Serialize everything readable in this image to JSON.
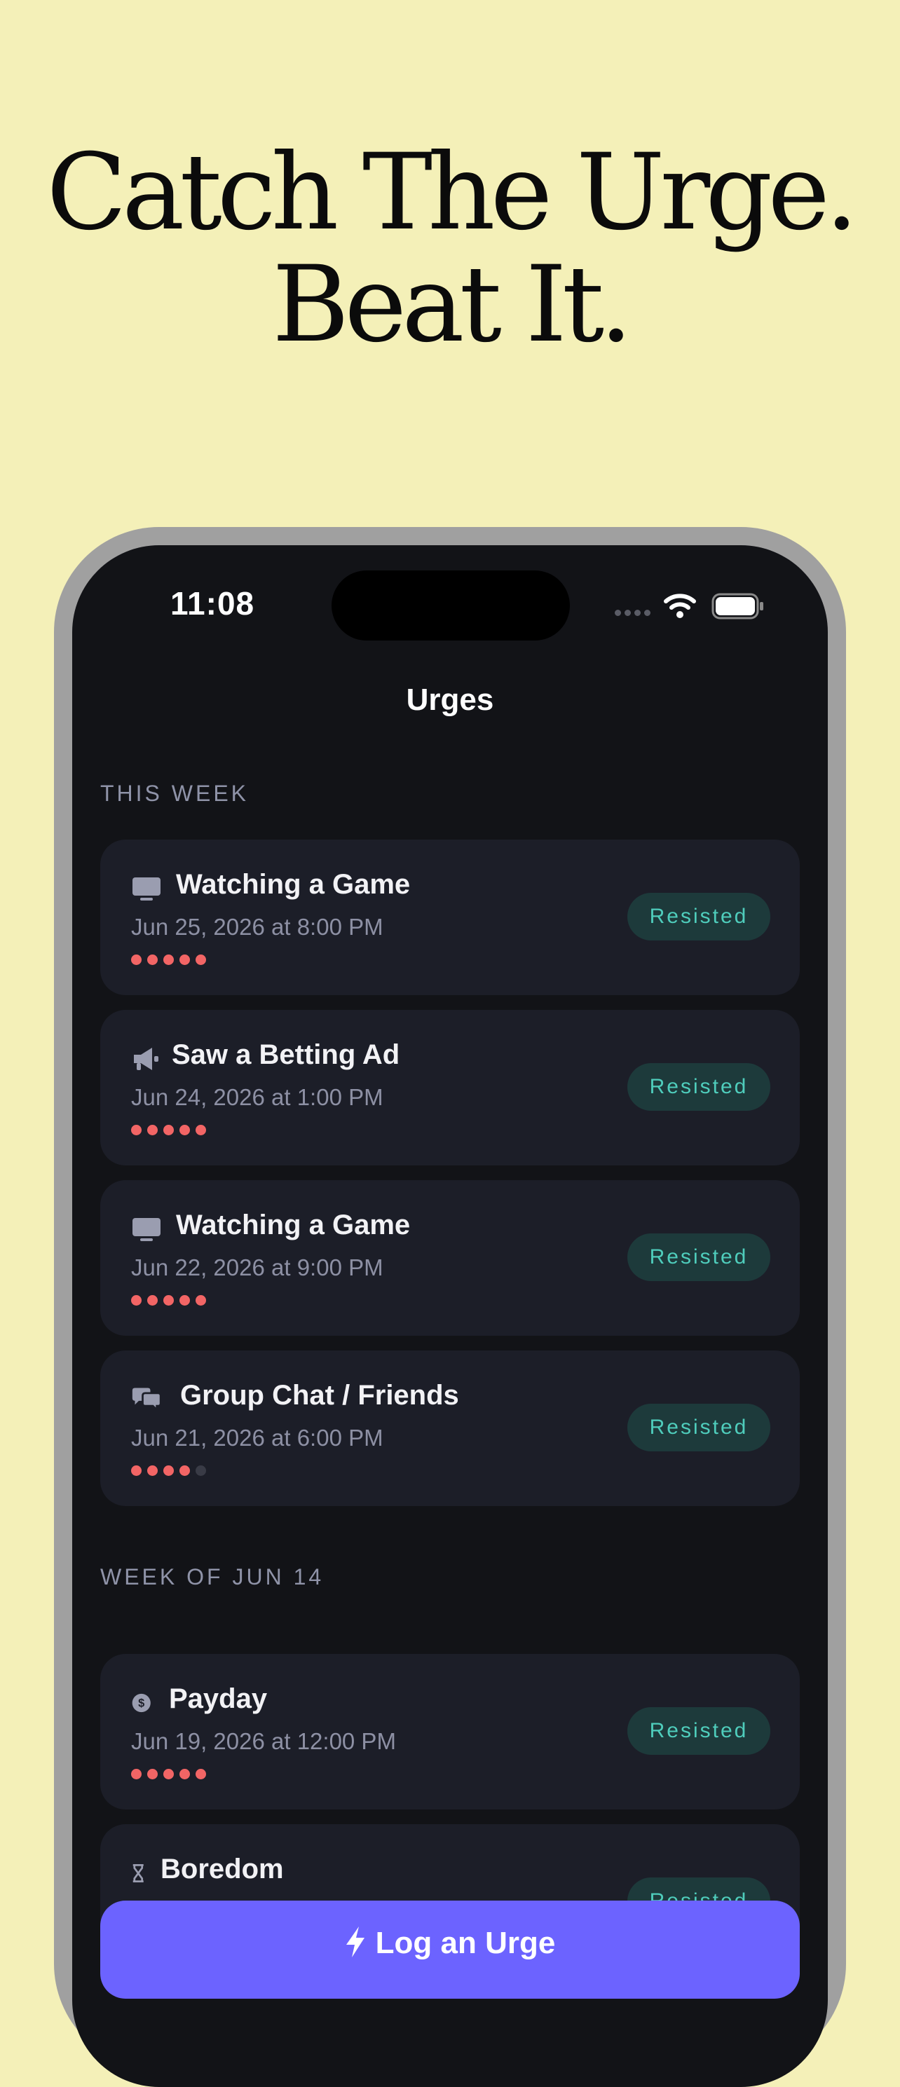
{
  "headline": {
    "line1": "Catch The Urge.",
    "line2": "Beat It."
  },
  "status_bar": {
    "time": "11:08"
  },
  "nav": {
    "title": "Urges"
  },
  "sections": [
    {
      "header": "THIS WEEK",
      "items": [
        {
          "icon": "tv-icon",
          "title": "Watching a Game",
          "date": "Jun 25, 2026 at 8:00 PM",
          "intensity": 5,
          "status": "Resisted"
        },
        {
          "icon": "megaphone-icon",
          "title": "Saw a Betting Ad",
          "date": "Jun 24, 2026 at 1:00 PM",
          "intensity": 5,
          "status": "Resisted"
        },
        {
          "icon": "tv-icon",
          "title": "Watching a Game",
          "date": "Jun 22, 2026 at 9:00 PM",
          "intensity": 5,
          "status": "Resisted"
        },
        {
          "icon": "chat-bubbles-icon",
          "title": "Group Chat / Friends",
          "date": "Jun 21, 2026 at 6:00 PM",
          "intensity": 4,
          "status": "Resisted"
        }
      ]
    },
    {
      "header": "WEEK OF JUN 14",
      "items": [
        {
          "icon": "dollar-coin-icon",
          "title": "Payday",
          "date": "Jun 19, 2026 at 12:00 PM",
          "intensity": 5,
          "status": "Resisted"
        },
        {
          "icon": "hourglass-icon",
          "title": "Boredom",
          "date": "",
          "intensity": 0,
          "status": "Resisted"
        }
      ]
    }
  ],
  "intensity_max": 5,
  "log_button": {
    "label": "Log an Urge",
    "icon": "bolt-icon"
  },
  "colors": {
    "background": "#f4f0b8",
    "screen": "#121317",
    "card": "#1c1e28",
    "accent": "#6c63ff",
    "resisted": "#4fcdbc",
    "intensity": "#f26565"
  }
}
